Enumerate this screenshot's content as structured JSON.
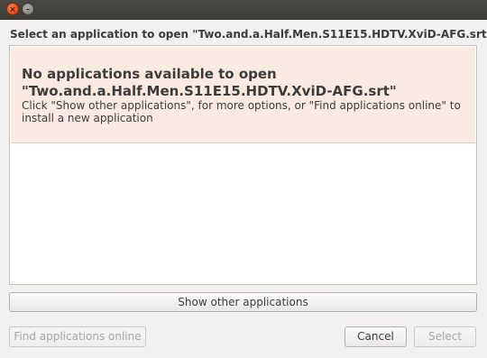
{
  "window": {
    "close_glyph": "×",
    "minimize_glyph": "–"
  },
  "dialog": {
    "heading": "Select an application to open \"Two.and.a.Half.Men.S11E15.HDTV.XviD-AFG.srt\"",
    "info": {
      "title_line1": "No applications available to open",
      "title_line2": "\"Two.and.a.Half.Men.S11E15.HDTV.XviD-AFG.srt\"",
      "description": "Click \"Show other applications\", for more options, or \"Find applications online\" to install a new application"
    },
    "buttons": {
      "show_other": "Show other applications",
      "find_online": "Find applications online",
      "cancel": "Cancel",
      "select": "Select"
    }
  },
  "colors": {
    "info_background": "#fbeae2",
    "close_button": "#e6531d"
  }
}
